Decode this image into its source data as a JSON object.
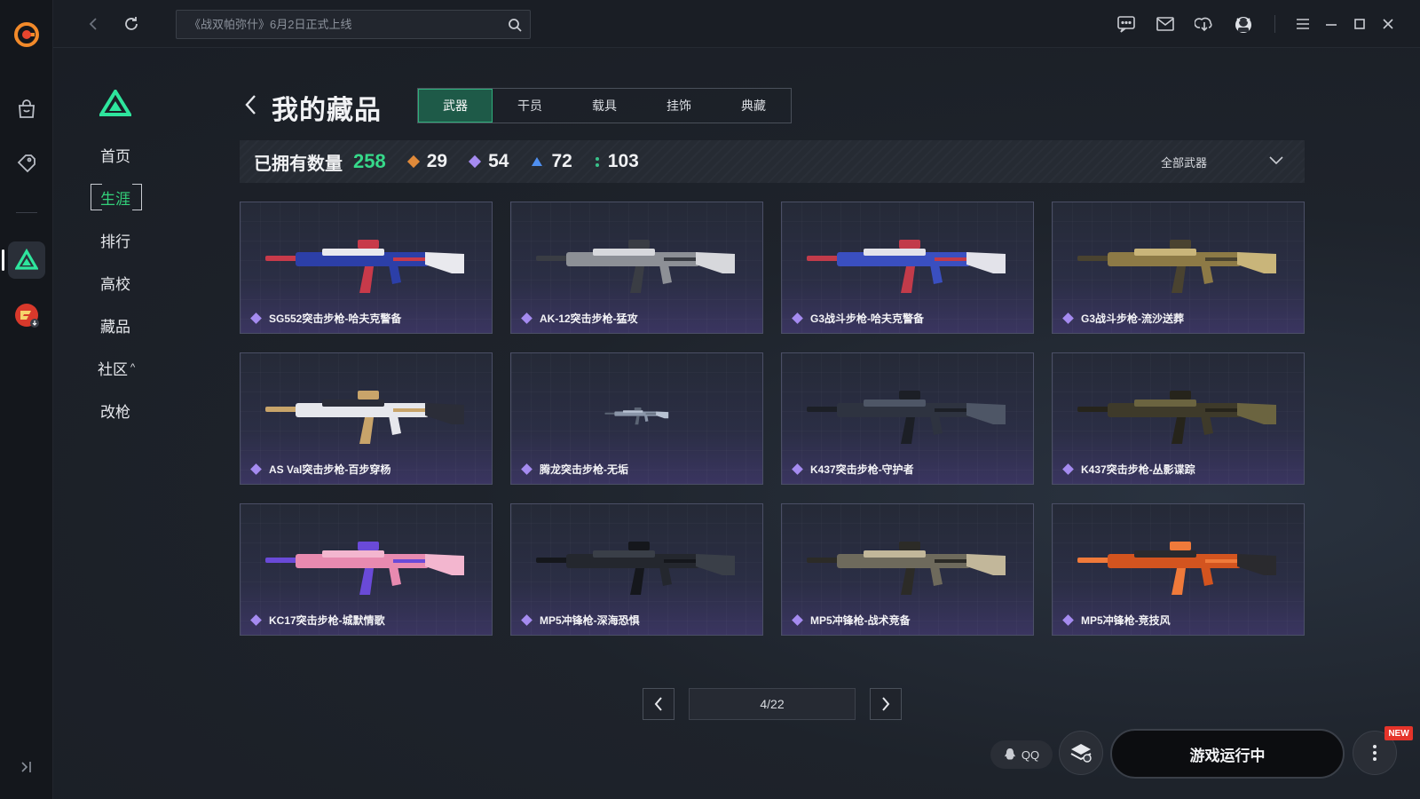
{
  "topbar": {
    "search_placeholder": "《战双帕弥什》6月2日正式上线"
  },
  "nav": {
    "items": [
      {
        "label": "首页",
        "active": false
      },
      {
        "label": "生涯",
        "active": true
      },
      {
        "label": "排行",
        "active": false
      },
      {
        "label": "高校",
        "active": false
      },
      {
        "label": "藏品",
        "active": false
      },
      {
        "label": "社区",
        "active": false,
        "chevron": "^"
      },
      {
        "label": "改枪",
        "active": false
      }
    ]
  },
  "header": {
    "title": "我的藏品",
    "tabs": [
      "武器",
      "干员",
      "载具",
      "挂饰",
      "典藏"
    ],
    "active_tab": "武器"
  },
  "stats": {
    "owned_label": "已拥有数量",
    "owned_count": "258",
    "rarities": [
      {
        "count": "29",
        "color": "#e08a3a"
      },
      {
        "count": "54",
        "color": "#a58bf0"
      },
      {
        "count": "72",
        "color": "#4f8ff0"
      },
      {
        "count": "103",
        "color": "#39c28a"
      }
    ],
    "filter_label": "全部武器"
  },
  "items": [
    {
      "name": "SG552突击步枪-哈夫克警备",
      "palette": [
        "#2c3fa8",
        "#e9e9ee",
        "#c83a4a"
      ]
    },
    {
      "name": "AK-12突击步枪-猛攻",
      "palette": [
        "#8d9096",
        "#d7d8dc",
        "#3a3d44"
      ]
    },
    {
      "name": "G3战斗步枪-哈夫克警备",
      "palette": [
        "#3a4fc0",
        "#e3e3ea",
        "#c23b4a"
      ]
    },
    {
      "name": "G3战斗步枪-流沙送葬",
      "palette": [
        "#8d7a46",
        "#c9b57a",
        "#4a4330"
      ]
    },
    {
      "name": "AS Val突击步枪-百步穿杨",
      "palette": [
        "#e6e7ec",
        "#2b2d38",
        "#c8a46a"
      ]
    },
    {
      "name": "腾龙突击步枪-无垢",
      "palette": [
        "#8a95a8",
        "#b8c2d2",
        "#5b6474"
      ]
    },
    {
      "name": "K437突击步枪-守护者",
      "palette": [
        "#2e3340",
        "#4e5666",
        "#1c1f26"
      ]
    },
    {
      "name": "K437突击步枪-丛影谍踪",
      "palette": [
        "#3e3a2a",
        "#6b6440",
        "#26241b"
      ]
    },
    {
      "name": "KC17突击步枪-城默情歌",
      "palette": [
        "#e88ab0",
        "#f3b6cf",
        "#6a4ad8"
      ]
    },
    {
      "name": "MP5冲锋枪-深海恐惧",
      "palette": [
        "#24272e",
        "#3a3f48",
        "#15171c"
      ]
    },
    {
      "name": "MP5冲锋枪-战术竞备",
      "palette": [
        "#6e6a5c",
        "#c2b79a",
        "#2c2b27"
      ]
    },
    {
      "name": "MP5冲锋枪-竞技风",
      "palette": [
        "#d3541f",
        "#2a2a2e",
        "#f07a3a"
      ]
    }
  ],
  "pagination": {
    "page": "4/22"
  },
  "bottom": {
    "qq_label": "QQ",
    "launch_label": "游戏运行中",
    "new_badge": "NEW"
  },
  "colors": {
    "accent_green": "#33d17a",
    "rarity_purple": "#a58bf0"
  }
}
